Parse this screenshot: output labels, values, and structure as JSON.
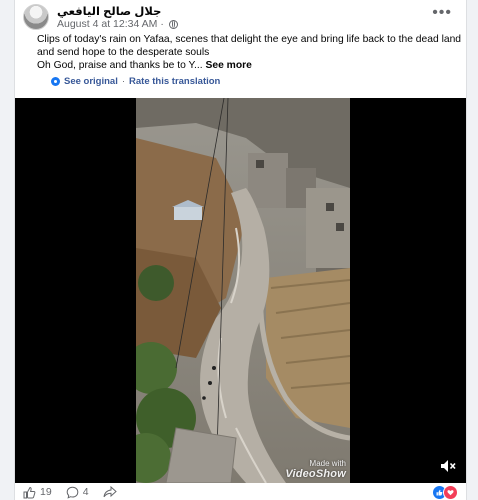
{
  "post": {
    "author": "جلال صالح اليافعي",
    "timestamp": "August 4 at 12:34 AM",
    "more_label": "•••",
    "text_line_1": "Clips of today's rain on Yafaa, scenes that delight the eye and bring life back to the dead land and send hope to the desperate souls",
    "text_line_2": "Oh God, praise and thanks be to Y...",
    "see_more_label": "See more",
    "see_original_label": "See original",
    "separator": "·",
    "rate_translation_label": "Rate this translation"
  },
  "video": {
    "watermark_top": "Made with",
    "watermark_brand": "VideoShow",
    "mute_icon": "speaker-muted-icon"
  },
  "footer": {
    "like_count": "19",
    "comment_count": "4",
    "reaction_icons": [
      "like-reaction-icon",
      "love-reaction-icon"
    ]
  },
  "colors": {
    "link": "#385898",
    "like_blue": "#1877f2",
    "love_red": "#f33e58",
    "meta_gray": "#65676b"
  }
}
